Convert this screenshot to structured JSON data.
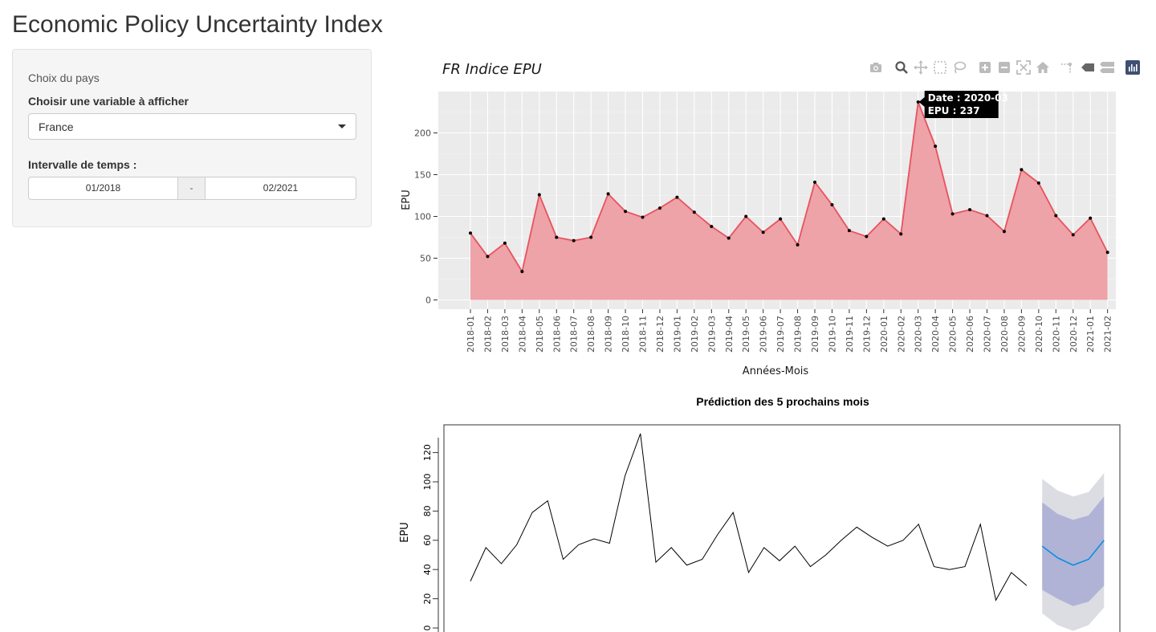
{
  "page": {
    "title": "Economic Policy Uncertainty Index"
  },
  "sidebar": {
    "section_title": "Choix du pays",
    "variable_label": "Choisir une variable à afficher",
    "variable_value": "France",
    "range_label": "Intervalle de temps :",
    "range_start": "01/2018",
    "range_sep": "-",
    "range_end": "02/2021"
  },
  "modebar": {
    "icons": [
      "camera-icon",
      "zoom-icon",
      "pan-icon",
      "box-select-icon",
      "lasso-select-icon",
      "zoom-in-icon",
      "zoom-out-icon",
      "autoscale-icon",
      "reset-axes-icon",
      "spike-lines-icon",
      "hover-closest-icon",
      "hover-compare-icon",
      "plotly-logo-icon"
    ]
  },
  "chart_data": [
    {
      "type": "area",
      "title": "FR Indice EPU",
      "xlabel": "Années-Mois",
      "ylabel": "EPU",
      "categories": [
        "2018-01",
        "2018-02",
        "2018-03",
        "2018-04",
        "2018-05",
        "2018-06",
        "2018-07",
        "2018-08",
        "2018-09",
        "2018-10",
        "2018-11",
        "2018-12",
        "2019-01",
        "2019-02",
        "2019-03",
        "2019-04",
        "2019-05",
        "2019-06",
        "2019-07",
        "2019-08",
        "2019-09",
        "2019-10",
        "2019-11",
        "2019-12",
        "2020-01",
        "2020-02",
        "2020-03",
        "2020-04",
        "2020-05",
        "2020-06",
        "2020-07",
        "2020-08",
        "2020-09",
        "2020-10",
        "2020-11",
        "2020-12",
        "2021-01",
        "2021-02"
      ],
      "values": [
        80,
        52,
        68,
        34,
        126,
        75,
        71,
        75,
        127,
        106,
        99,
        110,
        123,
        105,
        88,
        74,
        100,
        81,
        97,
        66,
        141,
        114,
        83,
        76,
        97,
        79,
        237,
        184,
        103,
        108,
        101,
        82,
        156,
        140,
        101,
        78,
        98,
        57
      ],
      "yticks": [
        0,
        50,
        100,
        150,
        200
      ],
      "ylim": [
        -12,
        250
      ],
      "grid": true,
      "colors": {
        "fill": "#eda3a8",
        "line": "#e8525e",
        "marker": "#000000",
        "panel": "#ebebeb"
      },
      "tooltip": {
        "line1": "Date : 2020-03",
        "line2": "EPU : 237",
        "index": 26
      }
    },
    {
      "type": "line",
      "title": "Prédiction des 5 prochains mois",
      "ylabel": "EPU",
      "values": [
        32,
        55,
        44,
        57,
        79,
        87,
        47,
        57,
        61,
        58,
        104,
        133,
        45,
        55,
        43,
        47,
        64,
        79,
        38,
        55,
        46,
        56,
        42,
        50,
        60,
        69,
        62,
        56,
        60,
        71,
        42,
        40,
        42,
        71,
        19,
        38,
        29
      ],
      "forecast": {
        "mean": [
          56,
          48,
          43,
          47,
          60
        ],
        "lo80": [
          26,
          20,
          15,
          18,
          29
        ],
        "hi80": [
          86,
          78,
          74,
          77,
          90
        ],
        "lo95": [
          10,
          2,
          -2,
          2,
          14
        ],
        "hi95": [
          102,
          94,
          90,
          93,
          106
        ]
      },
      "yticks": [
        0,
        20,
        40,
        60,
        80,
        100,
        120
      ],
      "colors": {
        "line": "#000000",
        "mean": "#0b8fe0",
        "band80": "#b0b3d6",
        "band95": "#dcdce3"
      }
    }
  ]
}
